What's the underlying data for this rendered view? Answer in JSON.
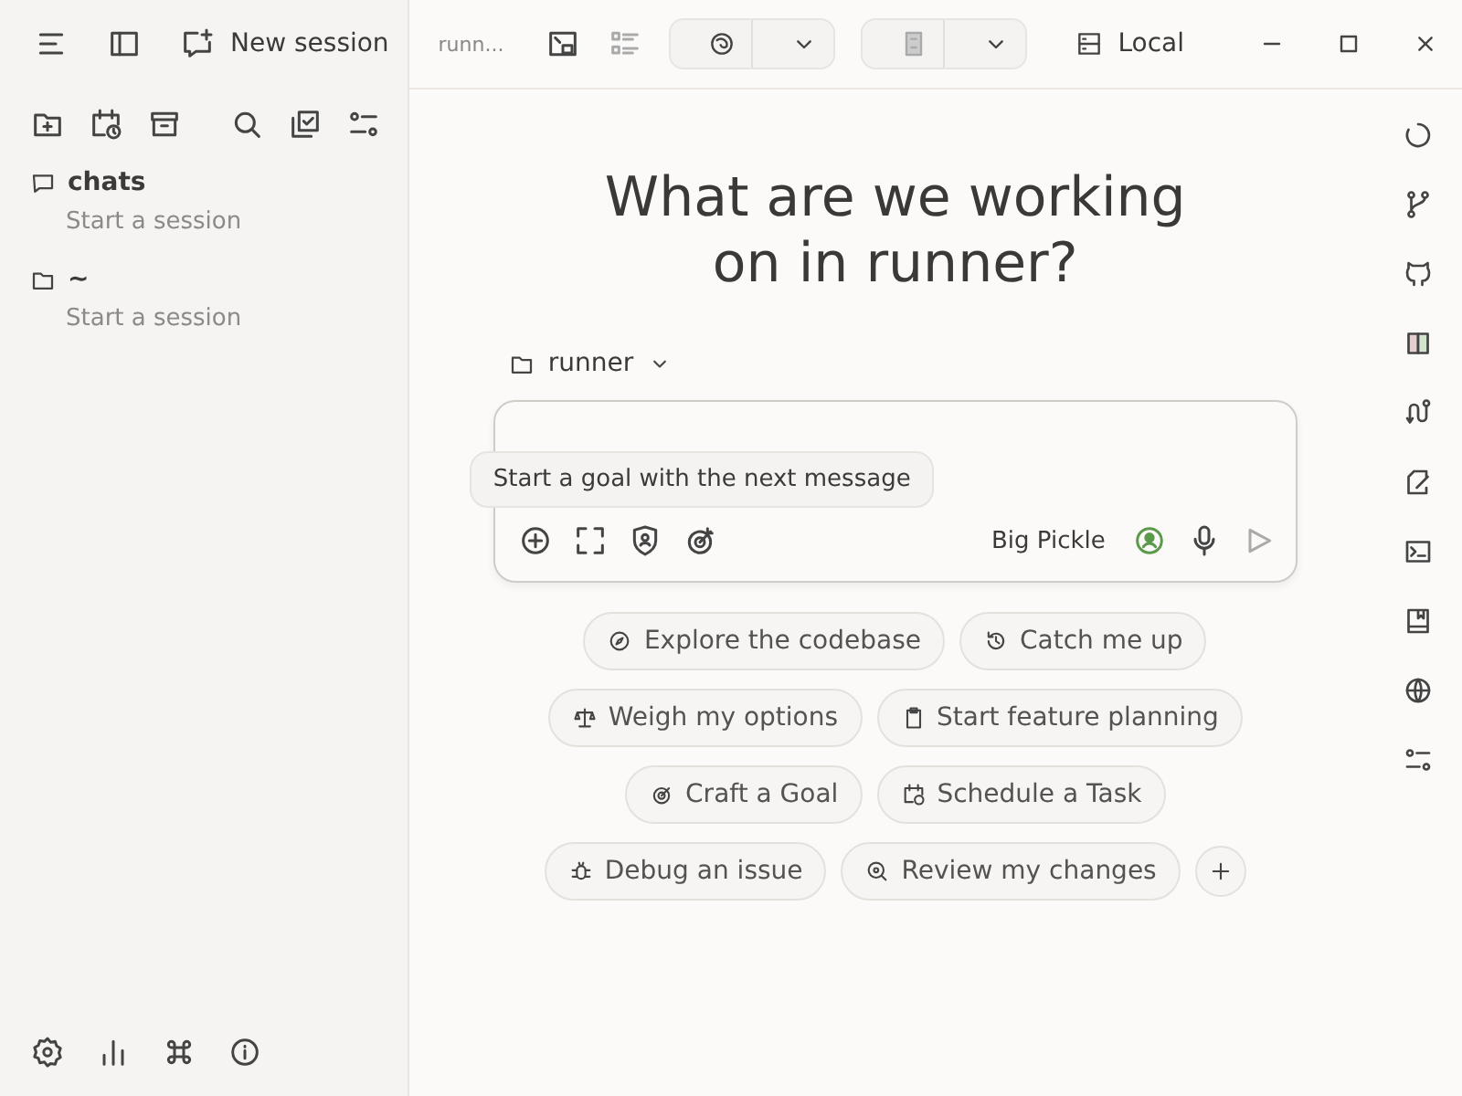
{
  "sidebar": {
    "new_session": "New session",
    "groups": [
      {
        "name": "chats",
        "empty": "Start a session"
      },
      {
        "name": "~",
        "empty": "Start a session"
      }
    ]
  },
  "topbar": {
    "session": "runn...",
    "environment": "Local"
  },
  "main": {
    "title": "What are we working on in runner?",
    "project": "runner",
    "tooltip": "Start a goal with the next message",
    "model": "Big Pickle",
    "suggestions": [
      [
        "Explore the codebase",
        "Catch me up"
      ],
      [
        "Weigh my options",
        "Start feature planning"
      ],
      [
        "Craft a Goal",
        "Schedule a Task"
      ],
      [
        "Debug an issue",
        "Review my changes"
      ]
    ]
  }
}
